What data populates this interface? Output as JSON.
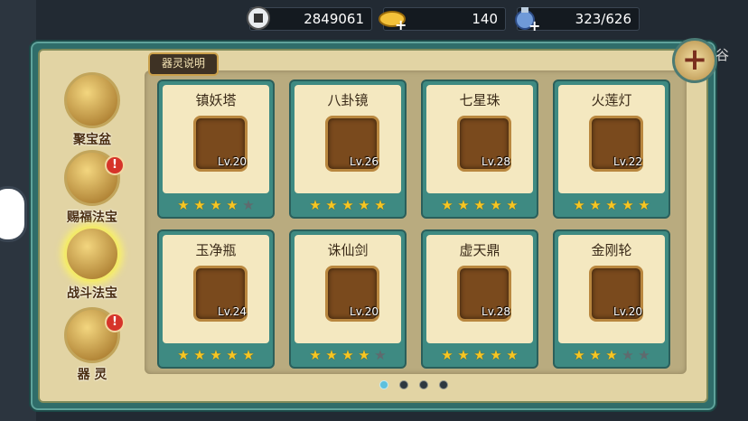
{
  "currency": {
    "coins": "2849061",
    "ingots": "140",
    "energy": "323/626"
  },
  "header_tag": "器灵说明",
  "edge_text": "谷",
  "nav": [
    {
      "label": "聚宝盆",
      "badge": ""
    },
    {
      "label": "赐福法宝",
      "badge": "!"
    },
    {
      "label": "战斗法宝",
      "badge": ""
    },
    {
      "label": "器 灵",
      "badge": "!"
    }
  ],
  "active_nav": "战斗法宝",
  "cards": [
    {
      "name": "镇妖塔",
      "level": "Lv.20",
      "stars": 4
    },
    {
      "name": "八卦镜",
      "level": "Lv.26",
      "stars": 5
    },
    {
      "name": "七星珠",
      "level": "Lv.28",
      "stars": 5
    },
    {
      "name": "火莲灯",
      "level": "Lv.22",
      "stars": 5
    },
    {
      "name": "玉净瓶",
      "level": "Lv.24",
      "stars": 5
    },
    {
      "name": "诛仙剑",
      "level": "Lv.20",
      "stars": 4
    },
    {
      "name": "虚天鼎",
      "level": "Lv.28",
      "stars": 5
    },
    {
      "name": "金刚轮",
      "level": "Lv.20",
      "stars": 3
    }
  ],
  "max_stars": 5,
  "pager": {
    "pages": 4,
    "current": 1
  },
  "colors": {
    "star_on": "#f6c623",
    "star_off": "#5f6a6e",
    "frame": "#2f6d6a"
  }
}
